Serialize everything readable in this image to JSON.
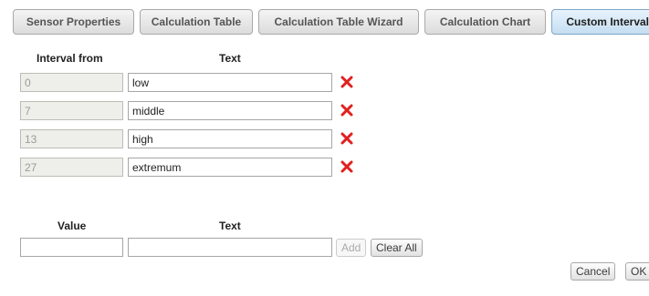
{
  "tabs": [
    {
      "label": "Sensor Properties",
      "active": false
    },
    {
      "label": "Calculation Table",
      "active": false
    },
    {
      "label": "Calculation Table Wizard",
      "active": false
    },
    {
      "label": "Calculation Chart",
      "active": false
    },
    {
      "label": "Custom Intervals",
      "active": true
    }
  ],
  "intervals": {
    "header_from": "Interval from",
    "header_text": "Text",
    "rows": [
      {
        "from": "0",
        "text": "low"
      },
      {
        "from": "7",
        "text": "middle"
      },
      {
        "from": "13",
        "text": "high"
      },
      {
        "from": "27",
        "text": "extremum"
      }
    ],
    "delete_icon": "red-x-icon",
    "delete_color": "#e02020"
  },
  "add": {
    "header_value": "Value",
    "header_text": "Text",
    "value": "",
    "text": "",
    "add_label": "Add",
    "clear_label": "Clear All"
  },
  "footer": {
    "cancel_label": "Cancel",
    "ok_label": "OK"
  }
}
